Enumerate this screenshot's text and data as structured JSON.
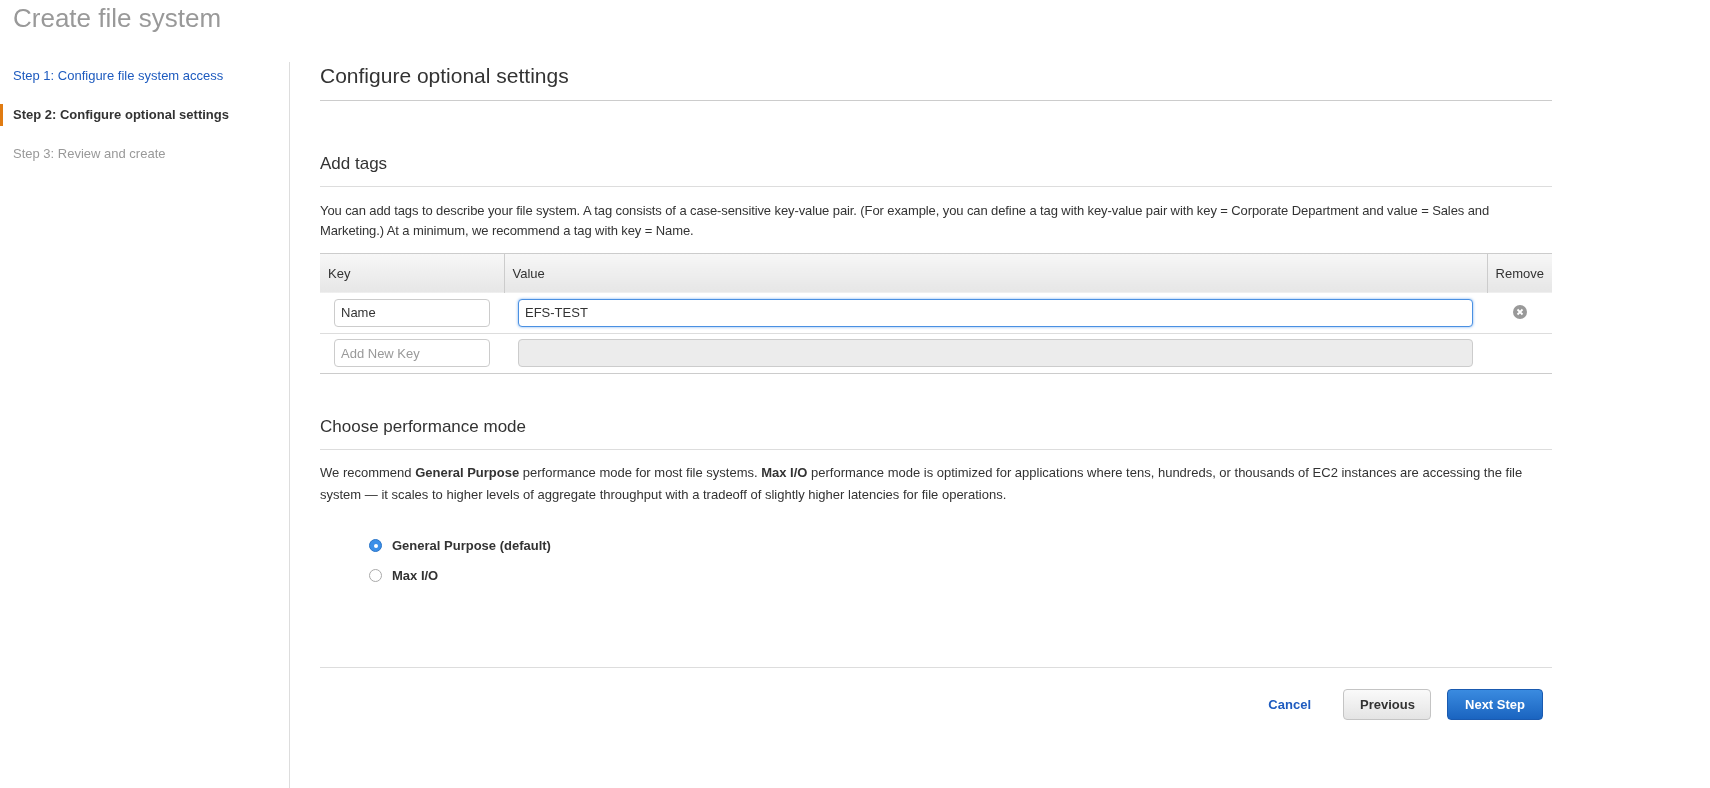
{
  "page_title": "Create file system",
  "steps": [
    {
      "label": "Step 1: Configure file system access",
      "selected": false,
      "disabled": false
    },
    {
      "label": "Step 2: Configure optional settings",
      "selected": true,
      "disabled": false
    },
    {
      "label": "Step 3: Review and create",
      "selected": false,
      "disabled": true
    }
  ],
  "heading": "Configure optional settings",
  "tags_section": {
    "title": "Add tags",
    "description": "You can add tags to describe your file system. A tag consists of a case-sensitive key-value pair. (For example, you can define a tag with key-value pair with key = Corporate Department and value = Sales and Marketing.) At a minimum, we recommend a tag with key = Name.",
    "columns": [
      "Key",
      "Value",
      "Remove"
    ],
    "rows": [
      {
        "key": {
          "value": "Name"
        },
        "value": {
          "value": "EFS-TEST",
          "focused": true,
          "disabled": false
        },
        "removable": true
      },
      {
        "key": {
          "placeholder": "Add New Key"
        },
        "value": {
          "focused": false,
          "disabled": true
        },
        "removable": false
      }
    ]
  },
  "performance_section": {
    "title": "Choose performance mode",
    "description": "We recommend **General Purpose** performance mode for most file systems. **Max I/O** performance mode is optimized for applications where tens, hundreds, or thousands of EC2 instances are accessing the file system — it scales to higher levels of aggregate throughput with a tradeoff of slightly higher latencies for file operations.",
    "options": [
      {
        "label": "General Purpose (default)",
        "selected": true
      },
      {
        "label": "Max I/O",
        "selected": false
      }
    ]
  },
  "buttons": [
    {
      "label": "Cancel",
      "kind": "link"
    },
    {
      "label": "Previous",
      "kind": "secondary"
    },
    {
      "label": "Next Step",
      "kind": "primary"
    }
  ]
}
